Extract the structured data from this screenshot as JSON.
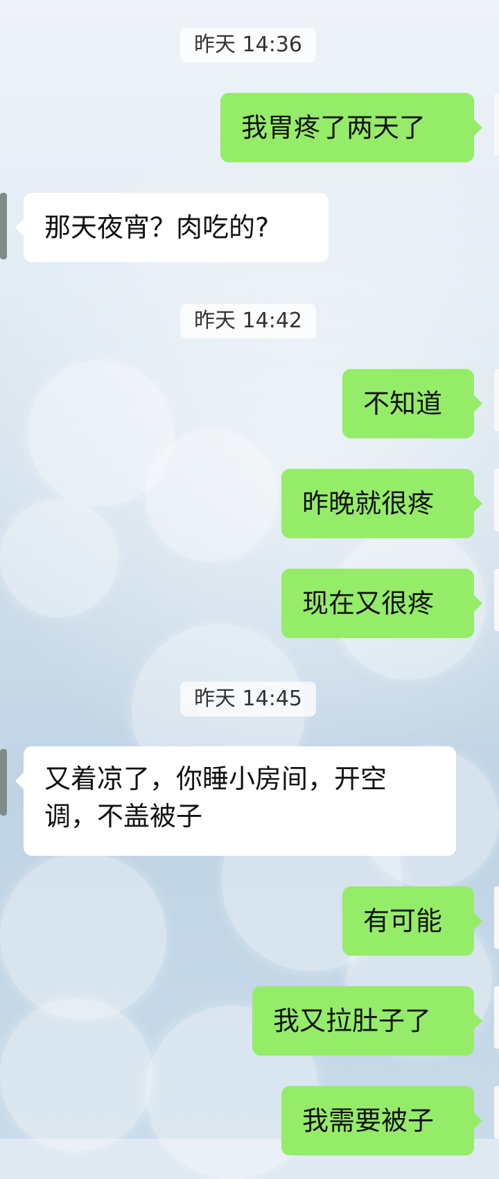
{
  "chat": {
    "timestamps": [
      "昨天 14:36",
      "昨天 14:42",
      "昨天 14:45"
    ],
    "messages": [
      {
        "side": "me",
        "text": "我胃疼了两天了"
      },
      {
        "side": "other",
        "text": "那天夜宵？肉吃的?"
      },
      {
        "side": "me",
        "text": "不知道"
      },
      {
        "side": "me",
        "text": "昨晚就很疼"
      },
      {
        "side": "me",
        "text": "现在又很疼"
      },
      {
        "side": "other",
        "text": "又着凉了，你睡小房间，开空调，不盖被子"
      },
      {
        "side": "me",
        "text": "有可能"
      },
      {
        "side": "me",
        "text": "我又拉肚子了"
      },
      {
        "side": "me",
        "text": "我需要被子"
      }
    ]
  },
  "colors": {
    "sent_bubble": "#95ec69",
    "received_bubble": "#ffffff",
    "timestamp_bg": "#ffffffbf"
  },
  "background": {
    "style": "light blue bokeh"
  }
}
